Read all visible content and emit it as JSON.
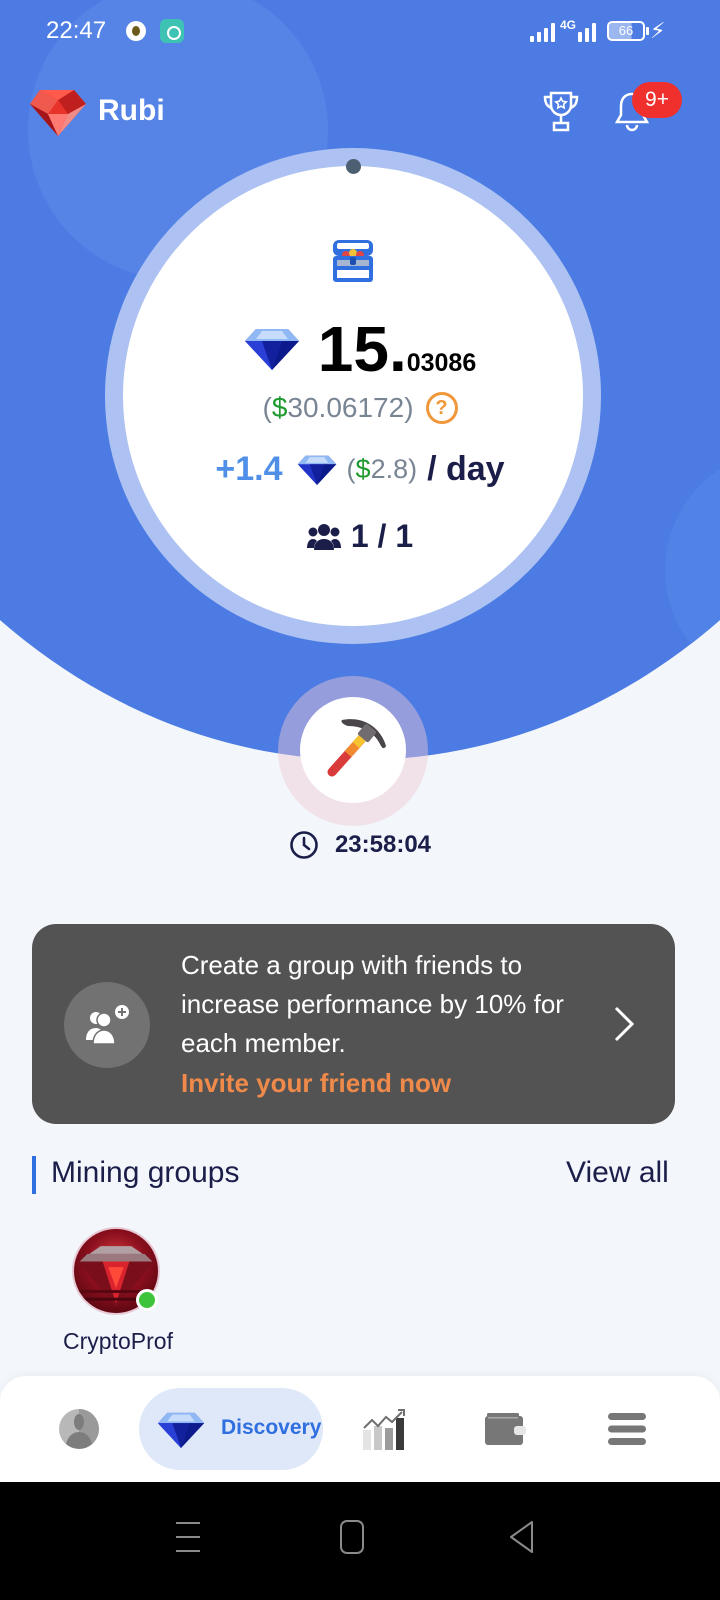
{
  "status_bar": {
    "time": "22:47",
    "network": "4G",
    "battery": "66",
    "charging_icon": "bolt-icon"
  },
  "app_bar": {
    "brand": "Rubi",
    "logo_icon": "ruby-gem-icon",
    "trophy_icon": "trophy-icon",
    "bell_icon": "bell-icon",
    "notification_badge": "9+"
  },
  "mining_card": {
    "chest_icon": "treasure-chest-icon",
    "balance_integer": "15.",
    "balance_decimals": "03086",
    "usd_open": "( ",
    "usd_symbol": "$",
    "usd_value": "30.06172",
    "usd_close": " )",
    "help_label": "?",
    "rate_value": "+1.4",
    "rate_usd_open": "(",
    "rate_usd_symbol": "$",
    "rate_usd_value": "2.8)",
    "rate_period": "/ day",
    "members": "1 / 1"
  },
  "mine_button": {
    "icon": "pickaxe-icon",
    "countdown": "23:58:04"
  },
  "promo": {
    "text": "Create a group with friends to increase performance by 10% for each member.",
    "link": "Invite your friend now",
    "icon": "add-group-icon"
  },
  "mining_groups": {
    "title": "Mining groups",
    "view_all": "View all",
    "groups": [
      {
        "name": "CryptoProf",
        "online": true
      }
    ]
  },
  "bottom_nav": {
    "items": [
      {
        "id": "profile",
        "icon": "profile-icon",
        "label": "",
        "active": false
      },
      {
        "id": "discovery",
        "icon": "gem-icon",
        "label": "Discovery",
        "active": true
      },
      {
        "id": "market",
        "icon": "chart-icon",
        "label": "",
        "active": false
      },
      {
        "id": "wallet",
        "icon": "wallet-icon",
        "label": "",
        "active": false
      },
      {
        "id": "menu",
        "icon": "menu-icon",
        "label": "",
        "active": false
      }
    ]
  },
  "colors": {
    "primary_blue": "#4b7be3",
    "accent_blue": "#2f6fe0",
    "rate_blue": "#4f8fe8",
    "usd_green": "#1f9a2e",
    "help_orange": "#f0973a",
    "invite_orange": "#f08a4a",
    "badge_red": "#f0302d",
    "promo_bg": "#535353",
    "online_green": "#3ec43a"
  }
}
